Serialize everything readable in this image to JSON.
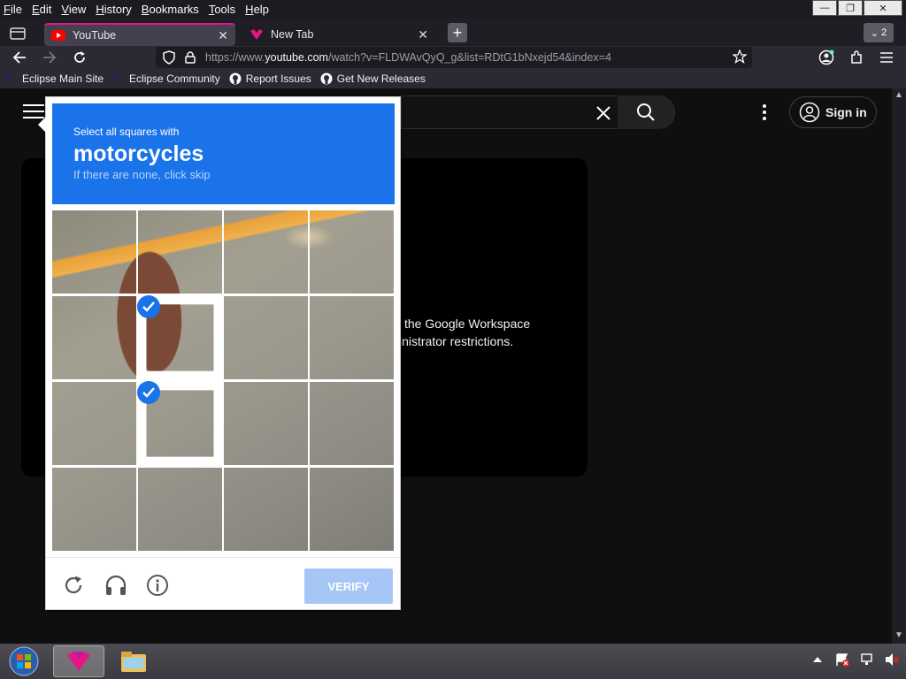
{
  "menubar": {
    "items": [
      "File",
      "Edit",
      "View",
      "History",
      "Bookmarks",
      "Tools",
      "Help"
    ]
  },
  "tabs": [
    {
      "title": "YouTube",
      "icon": "youtube-icon",
      "active": true
    },
    {
      "title": "New Tab",
      "icon": "firefox-developer-icon",
      "active": false
    }
  ],
  "tab_count": "2",
  "navbar": {
    "url_prefix": "https://www.",
    "url_domain": "youtube.com",
    "url_rest": "/watch?v=FLDWAvQyQ_g&list=RDtG1bNxejd54&index=4"
  },
  "bookmarks": [
    {
      "label": "Eclipse Main Site",
      "icon": "eclipse-icon"
    },
    {
      "label": "Eclipse Community",
      "icon": "eclipse-icon"
    },
    {
      "label": "Report Issues",
      "icon": "github-icon"
    },
    {
      "label": "Get New Releases",
      "icon": "github-icon"
    }
  ],
  "youtube": {
    "signin_label": "Sign in",
    "player_message_line1": "the Google Workspace",
    "player_message_line2": "inistrator restrictions."
  },
  "captcha": {
    "instruction": "Select all squares with",
    "target": "motorcycles",
    "hint": "If there are none, click skip",
    "verify_label": "VERIFY",
    "selected_tiles": [
      5,
      9
    ],
    "colors": {
      "header": "#1a73e8",
      "verify": "#a6c7f5"
    }
  }
}
